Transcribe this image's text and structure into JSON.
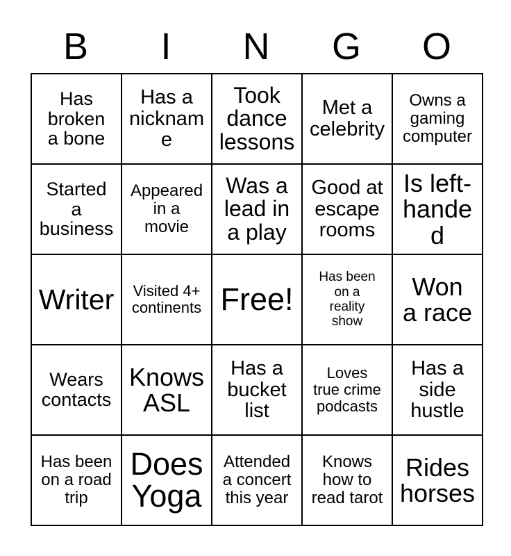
{
  "card": {
    "header_letters": [
      "B",
      "I",
      "N",
      "G",
      "O"
    ],
    "rows": 5,
    "columns": 5,
    "colors": {
      "background": "#ffffff",
      "text": "#000000",
      "border": "#000000"
    },
    "cells": [
      [
        {
          "text": "Has\nbroken\na bone",
          "size": "m"
        },
        {
          "text": "Has a\nnickname",
          "size": "ml"
        },
        {
          "text": "Took\ndance\nlessons",
          "size": "l"
        },
        {
          "text": "Met a\ncelebrity",
          "size": "ml"
        },
        {
          "text": "Owns a\ngaming\ncomputer",
          "size": "sm"
        }
      ],
      [
        {
          "text": "Started\na\nbusiness",
          "size": "m"
        },
        {
          "text": "Appeared\nin a\nmovie",
          "size": "sm"
        },
        {
          "text": "Was a\nlead in\na play",
          "size": "l"
        },
        {
          "text": "Good at\nescape\nrooms",
          "size": "ml"
        },
        {
          "text": "Is left-\nhanded",
          "size": "xl"
        }
      ],
      [
        {
          "text": "Writer",
          "size": "xxl"
        },
        {
          "text": "Visited 4+\ncontinents",
          "size": "s"
        },
        {
          "text": "Free!",
          "size": "huge",
          "free": true
        },
        {
          "text": "Has been\non a\nreality\nshow",
          "size": "xs"
        },
        {
          "text": "Won\na race",
          "size": "xl"
        }
      ],
      [
        {
          "text": "Wears\ncontacts",
          "size": "m"
        },
        {
          "text": "Knows\nASL",
          "size": "xl"
        },
        {
          "text": "Has a\nbucket\nlist",
          "size": "ml"
        },
        {
          "text": "Loves\ntrue crime\npodcasts",
          "size": "s"
        },
        {
          "text": "Has a\nside\nhustle",
          "size": "ml"
        }
      ],
      [
        {
          "text": "Has been\non a road\ntrip",
          "size": "sm"
        },
        {
          "text": "Does\nYoga",
          "size": "huge"
        },
        {
          "text": "Attended\na concert\nthis year",
          "size": "sm"
        },
        {
          "text": "Knows\nhow to\nread tarot",
          "size": "sm"
        },
        {
          "text": "Rides\nhorses",
          "size": "xl"
        }
      ]
    ]
  }
}
